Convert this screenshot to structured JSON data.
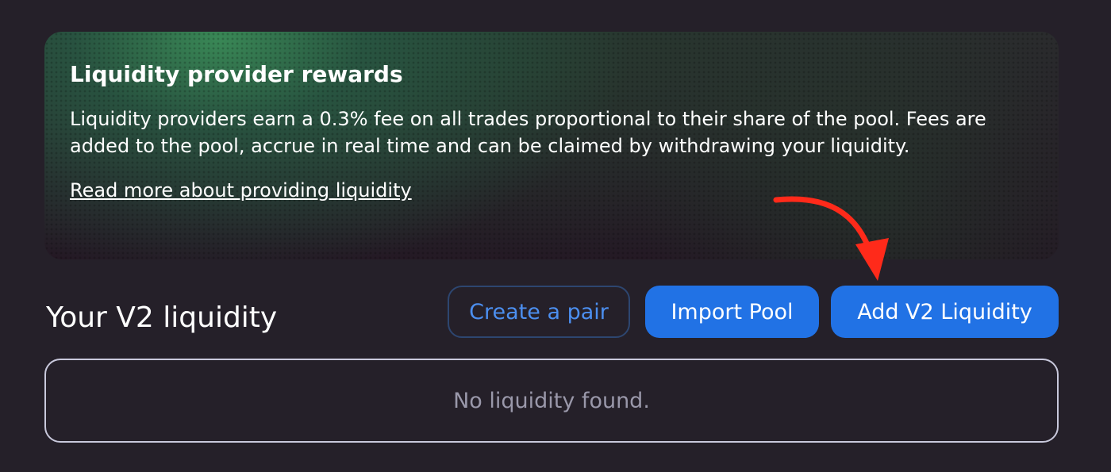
{
  "rewards": {
    "title": "Liquidity provider rewards",
    "body": "Liquidity providers earn a 0.3% fee on all trades proportional to their share of the pool. Fees are added to the pool, accrue in real time and can be claimed by withdrawing your liquidity.",
    "link_label": "Read more about providing liquidity"
  },
  "liquidity": {
    "title": "Your V2 liquidity",
    "create_pair_label": "Create a pair",
    "import_pool_label": "Import Pool",
    "add_liquidity_label": "Add V2 Liquidity",
    "empty_message": "No liquidity found."
  },
  "colors": {
    "background": "#252029",
    "accent": "#2172e5",
    "annotation_arrow": "#ff2a1a"
  },
  "icons": {
    "annotation": "curved-arrow-icon"
  }
}
